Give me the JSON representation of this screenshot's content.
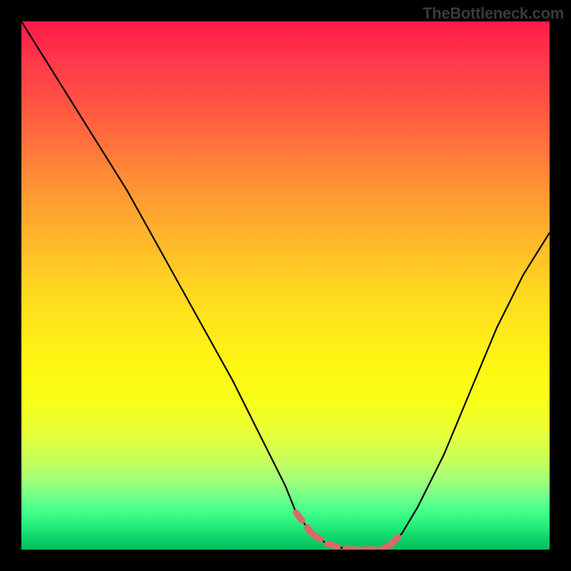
{
  "watermark": "TheBottleneck.com",
  "chart_data": {
    "type": "line",
    "title": "",
    "xlabel": "",
    "ylabel": "",
    "xlim": [
      0,
      100
    ],
    "ylim": [
      0,
      100
    ],
    "grid": false,
    "background_gradient": {
      "orientation": "vertical",
      "stops": [
        {
          "pos": 0.0,
          "color": "#ff1a4a"
        },
        {
          "pos": 0.5,
          "color": "#ffe000"
        },
        {
          "pos": 1.0,
          "color": "#00c060"
        }
      ]
    },
    "series": [
      {
        "name": "bottleneck-curve",
        "color": "#000000",
        "x": [
          0,
          5,
          10,
          15,
          20,
          25,
          30,
          35,
          40,
          45,
          50,
          52,
          55,
          58,
          62,
          65,
          68,
          70,
          72,
          75,
          80,
          85,
          90,
          95,
          100
        ],
        "values": [
          100,
          92,
          84,
          76,
          68,
          59,
          50,
          41,
          32,
          22,
          12,
          7,
          3,
          1,
          0,
          0,
          0,
          1,
          3,
          8,
          18,
          30,
          42,
          52,
          60
        ]
      }
    ],
    "highlight_segments": [
      {
        "name": "red-dashes",
        "color": "#d86a6a",
        "points": [
          [
            52,
            7
          ],
          [
            55,
            3
          ],
          [
            58,
            1
          ],
          [
            62,
            0
          ],
          [
            65,
            0
          ],
          [
            68,
            0
          ],
          [
            70,
            1
          ],
          [
            72,
            3
          ]
        ]
      }
    ]
  }
}
